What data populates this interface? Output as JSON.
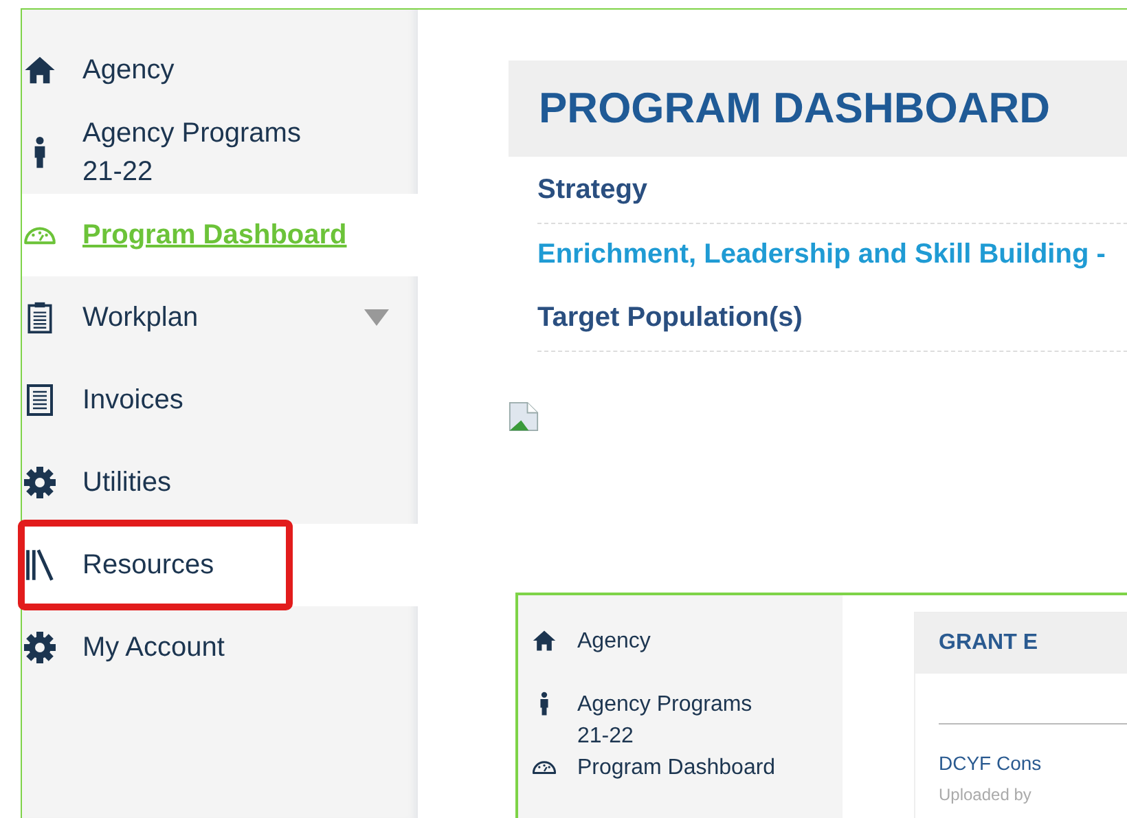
{
  "sidebar": {
    "items": [
      {
        "kind": "home",
        "label": "Agency",
        "selected": false,
        "highlighted": false
      },
      {
        "kind": "person",
        "label": "Agency Programs 21-22",
        "selected": false,
        "highlighted": false
      },
      {
        "kind": "gauge",
        "label": "Program Dashboard",
        "selected": true,
        "highlighted": false
      },
      {
        "kind": "clipboard",
        "label": "Workplan",
        "selected": false,
        "highlighted": false,
        "expanded": false
      },
      {
        "kind": "document",
        "label": "Invoices",
        "selected": false,
        "highlighted": false
      },
      {
        "kind": "gear",
        "label": "Utilities",
        "selected": false,
        "highlighted": false
      },
      {
        "kind": "books",
        "label": "Resources",
        "selected": false,
        "highlighted": true
      },
      {
        "kind": "gear",
        "label": "My Account",
        "selected": false,
        "highlighted": false
      }
    ]
  },
  "main": {
    "title": "PROGRAM DASHBOARD",
    "rows": [
      {
        "kind": "label",
        "text": "Strategy"
      },
      {
        "kind": "link",
        "text": "Enrichment, Leadership and Skill Building -"
      },
      {
        "kind": "label",
        "text": "Target Population(s)"
      }
    ],
    "embedded_screenshot": {
      "sidebar": [
        {
          "kind": "home",
          "label": "Agency"
        },
        {
          "kind": "person",
          "label": "Agency Programs 21-22"
        },
        {
          "kind": "gauge",
          "label": "Program Dashboard"
        }
      ],
      "card_title": "GRANT E",
      "document_link": "DCYF Cons",
      "document_meta": "Uploaded by"
    }
  }
}
